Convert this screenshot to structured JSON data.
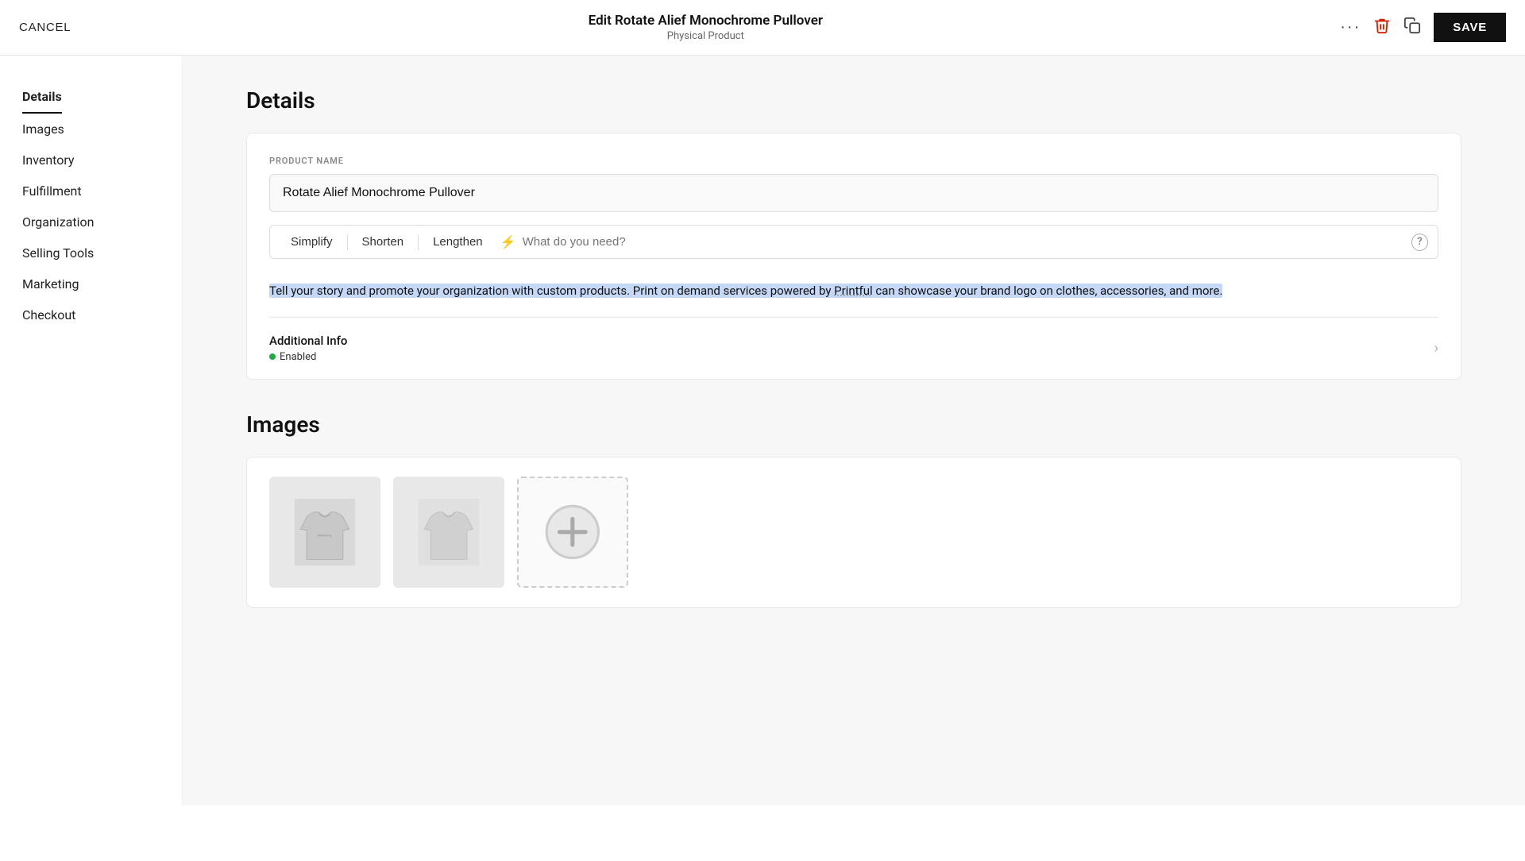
{
  "topbar": {
    "cancel_label": "CANCEL",
    "title": "Edit Rotate Alief Monochrome Pullover",
    "subtitle": "Physical Product",
    "save_label": "SAVE"
  },
  "sidebar": {
    "items": [
      {
        "id": "details",
        "label": "Details",
        "active": true
      },
      {
        "id": "images",
        "label": "Images",
        "active": false
      },
      {
        "id": "inventory",
        "label": "Inventory",
        "active": false
      },
      {
        "id": "fulfillment",
        "label": "Fulfillment",
        "active": false
      },
      {
        "id": "organization",
        "label": "Organization",
        "active": false
      },
      {
        "id": "selling-tools",
        "label": "Selling Tools",
        "active": false
      },
      {
        "id": "marketing",
        "label": "Marketing",
        "active": false
      },
      {
        "id": "checkout",
        "label": "Checkout",
        "active": false
      }
    ]
  },
  "details": {
    "section_title": "Details",
    "product_name_label": "PRODUCT NAME",
    "product_name_value": "Rotate Alief Monochrome Pullover",
    "ai_toolbar": {
      "simplify_label": "Simplify",
      "shorten_label": "Shorten",
      "lengthen_label": "Lengthen",
      "input_placeholder": "What do you need?"
    },
    "description_text": "Tell your story and promote your organization with custom products. Print on demand services powered by Printful can showcase your brand logo on clothes, accessories, and more.",
    "additional_info": {
      "label": "Additional Info",
      "status": "Enabled"
    }
  },
  "images": {
    "section_title": "Images"
  },
  "icons": {
    "dots": "···",
    "trash": "🗑",
    "duplicate": "⧉",
    "bolt": "⚡",
    "help": "?",
    "chevron_right": "›",
    "plus": "+"
  }
}
